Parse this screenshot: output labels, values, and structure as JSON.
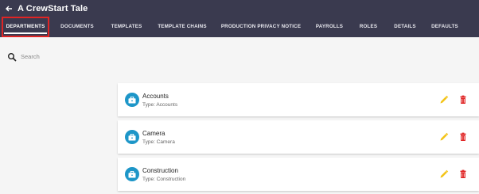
{
  "app": {
    "title": "A CrewStart Tale"
  },
  "tabs": [
    {
      "label": "DEPARTMENTS",
      "active": true
    },
    {
      "label": "DOCUMENTS"
    },
    {
      "label": "TEMPLATES"
    },
    {
      "label": "TEMPLATE CHAINS"
    },
    {
      "label": "PRODUCTION PRIVACY NOTICE"
    },
    {
      "label": "PAYROLLS"
    },
    {
      "label": "ROLES"
    },
    {
      "label": "DETAILS"
    },
    {
      "label": "DEFAULTS"
    }
  ],
  "search": {
    "placeholder": "Search"
  },
  "departments": [
    {
      "name": "Accounts",
      "type": "Type: Accounts"
    },
    {
      "name": "Camera",
      "type": "Type: Camera"
    },
    {
      "name": "Construction",
      "type": "Type: Construction"
    }
  ],
  "colors": {
    "header": "#3a3a4f",
    "avatar": "#1d96c8",
    "edit": "#f3c316",
    "delete": "#e02424"
  },
  "icons": {
    "back": "arrow-left-icon",
    "search": "search-icon",
    "department": "briefcase-icon",
    "edit": "pencil-icon",
    "delete": "trash-icon"
  }
}
